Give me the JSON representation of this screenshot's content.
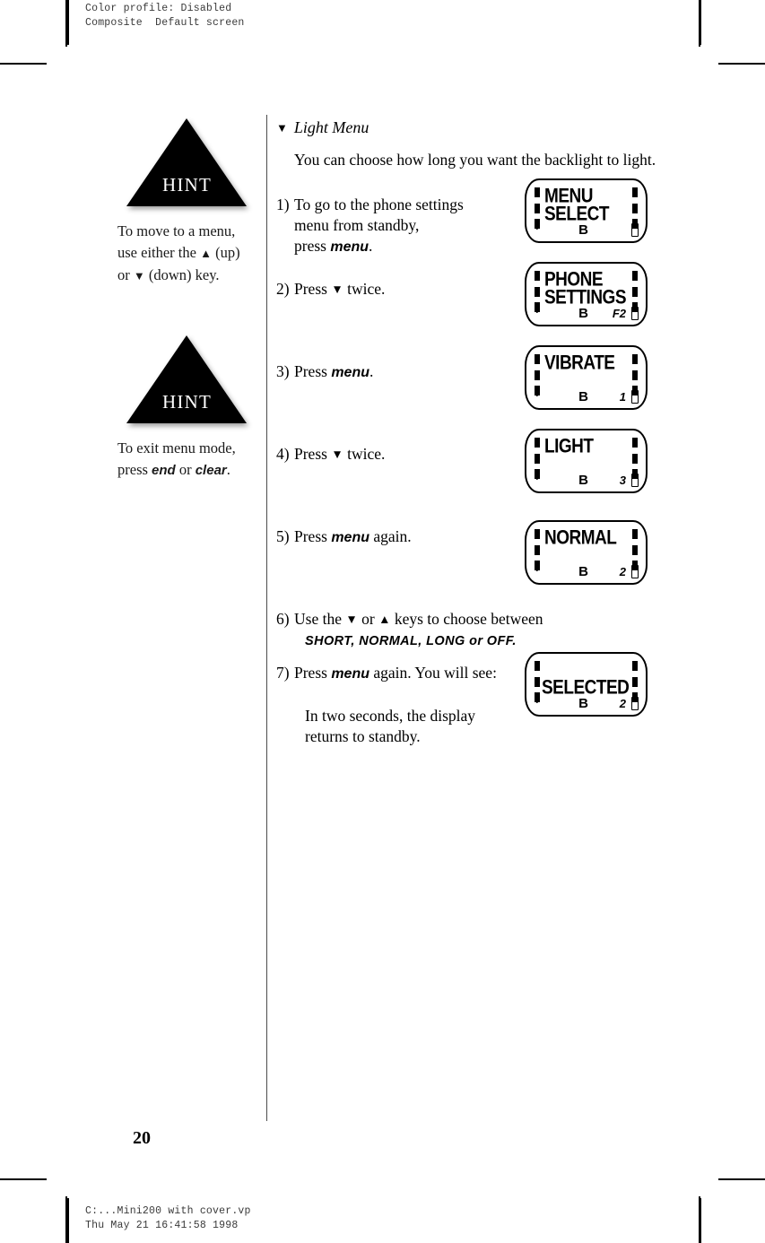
{
  "proof": {
    "header_line1": "Color profile: Disabled",
    "header_line2": "Composite  Default screen",
    "footer_line1": "C:...Mini200 with cover.vp",
    "footer_line2": "Thu May 21 16:41:58 1998"
  },
  "page": {
    "folio": "20"
  },
  "hints": [
    {
      "badge": "HINT",
      "line1": "To move to a menu,",
      "line2_pre": "use either the ",
      "line2_up": "▲",
      "line2_mid": " (up)",
      "line3_pre": "or ",
      "line3_down": "▼",
      "line3_post": " (down) key."
    },
    {
      "badge": "HINT",
      "line1": "To exit menu mode,",
      "line2_pre": "press ",
      "line2_key1": "end",
      "line2_mid": " or ",
      "line2_key2": "clear",
      "line2_post": "."
    }
  ],
  "section": {
    "marker": "▼",
    "title": "Light Menu",
    "intro": "You can choose how long you want the backlight to light."
  },
  "steps": [
    {
      "num": "1)",
      "text_line1": "To go to the phone settings",
      "text_line2": "menu from standby,",
      "text_line3_pre": "press ",
      "text_line3_key": "menu",
      "text_line3_post": "."
    },
    {
      "num": "2)",
      "text_pre": "Press ",
      "arrow": "▼",
      "text_post": " twice."
    },
    {
      "num": "3)",
      "text_pre": "Press ",
      "key": "menu",
      "text_post": "."
    },
    {
      "num": "4)",
      "text_pre": "Press ",
      "arrow": "▼",
      "text_post": " twice."
    },
    {
      "num": "5)",
      "text_pre": "Press ",
      "key": "menu",
      "text_post": " again."
    },
    {
      "num": "6)",
      "text_pre": "Use the ",
      "arrow_down": "▼",
      "text_mid": " or ",
      "arrow_up": "▲",
      "text_post": " keys to choose between",
      "options": "SHORT, NORMAL, LONG or OFF."
    },
    {
      "num": "7)",
      "text_pre": "Press ",
      "key": "menu",
      "text_post": " again. You will see:",
      "note_line1": "In two seconds, the display",
      "note_line2": "returns to standby."
    }
  ],
  "screens": [
    {
      "name": "menu-select",
      "line1": "MENU",
      "line2": "SELECT",
      "signal": "ᵛ",
      "letter": "B",
      "index": ""
    },
    {
      "name": "phone-settings",
      "line1": "PHONE",
      "line2": "SETTINGS",
      "signal": "ᵛ",
      "letter": "B",
      "index": "F2"
    },
    {
      "name": "vibrate",
      "line1": "VIBRATE",
      "line2": "",
      "signal": "ᵛ",
      "letter": "B",
      "index": "1"
    },
    {
      "name": "light",
      "line1": "LIGHT",
      "line2": "",
      "signal": "ᵛ",
      "letter": "B",
      "index": "3"
    },
    {
      "name": "normal",
      "line1": "NORMAL",
      "line2": "",
      "signal": "ᵛ",
      "letter": "B",
      "index": "2"
    },
    {
      "name": "selected",
      "line1": "",
      "line2": "SELECTED",
      "signal": "ᵛ",
      "letter": "B",
      "index": "2"
    }
  ]
}
